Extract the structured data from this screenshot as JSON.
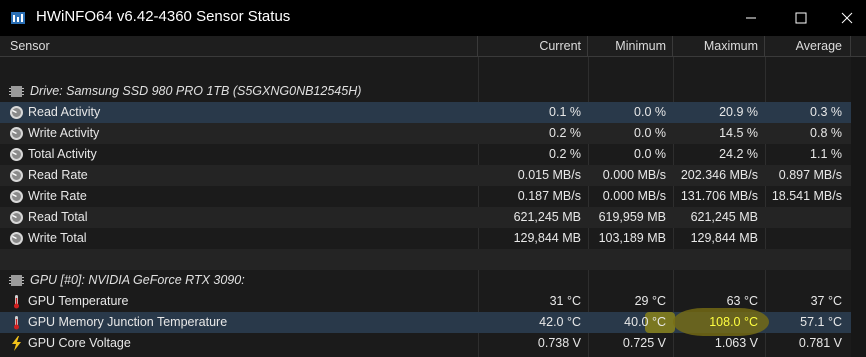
{
  "window": {
    "title": "HWiNFO64 v6.42-4360 Sensor Status"
  },
  "columns": {
    "sensor": "Sensor",
    "current": "Current",
    "minimum": "Minimum",
    "maximum": "Maximum",
    "average": "Average"
  },
  "groups": [
    {
      "label": "Drive: Samsung SSD 980 PRO 1TB (S5GXNG0NB12545H)",
      "icon": "drive-chip-icon",
      "rows": [
        {
          "name": "Read Activity",
          "icon": "gauge-icon",
          "current": "0.1 %",
          "min": "0.0 %",
          "max": "20.9 %",
          "avg": "0.3 %"
        },
        {
          "name": "Write Activity",
          "icon": "gauge-icon",
          "current": "0.2 %",
          "min": "0.0 %",
          "max": "14.5 %",
          "avg": "0.8 %"
        },
        {
          "name": "Total Activity",
          "icon": "gauge-icon",
          "current": "0.2 %",
          "min": "0.0 %",
          "max": "24.2 %",
          "avg": "1.1 %"
        },
        {
          "name": "Read Rate",
          "icon": "gauge-icon",
          "current": "0.015 MB/s",
          "min": "0.000 MB/s",
          "max": "202.346 MB/s",
          "avg": "0.897 MB/s"
        },
        {
          "name": "Write Rate",
          "icon": "gauge-icon",
          "current": "0.187 MB/s",
          "min": "0.000 MB/s",
          "max": "131.706 MB/s",
          "avg": "18.541 MB/s"
        },
        {
          "name": "Read Total",
          "icon": "gauge-icon",
          "current": "621,245 MB",
          "min": "619,959 MB",
          "max": "621,245 MB",
          "avg": ""
        },
        {
          "name": "Write Total",
          "icon": "gauge-icon",
          "current": "129,844 MB",
          "min": "103,189 MB",
          "max": "129,844 MB",
          "avg": ""
        }
      ]
    },
    {
      "label": "GPU [#0]: NVIDIA GeForce RTX 3090:",
      "icon": "gpu-chip-icon",
      "rows": [
        {
          "name": "GPU Temperature",
          "icon": "thermometer-icon",
          "current": "31 °C",
          "min": "29 °C",
          "max": "63 °C",
          "avg": "37 °C"
        },
        {
          "name": "GPU Memory Junction Temperature",
          "icon": "thermometer-icon",
          "current": "42.0 °C",
          "min": "40.0 °C",
          "max": "108.0 °C",
          "avg": "57.1 °C"
        },
        {
          "name": "GPU Core Voltage",
          "icon": "lightning-icon",
          "current": "0.738 V",
          "min": "0.725 V",
          "max": "1.063 V",
          "avg": "0.781 V"
        }
      ]
    }
  ],
  "colors": {
    "selected_row": "#29394a",
    "highlight": "#8c8214"
  }
}
